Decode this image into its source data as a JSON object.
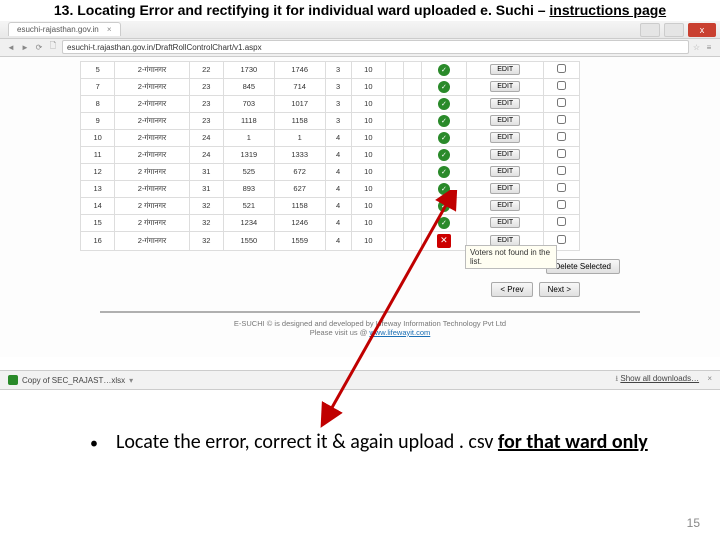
{
  "slide": {
    "title_prefix": "13.  Locating Error and rectifying it for individual ward uploaded e. Suchi – ",
    "title_underlined": "instructions page",
    "page_number": "15"
  },
  "browser": {
    "tab_title": "esuchi-rajasthan.gov.in",
    "url": "esuchi-t.rajasthan.gov.in/DraftRollControlChart/v1.aspx",
    "close_label": "x"
  },
  "tooltip": "Voters not found in the list.",
  "actions": {
    "edit": "EDIT",
    "delete_selected": "Delete Selected",
    "prev": "< Prev",
    "next": "Next >"
  },
  "footer": {
    "line1": "E-SUCHI © is designed and developed by Lifeway Information Technology Pvt Ltd",
    "line2_prefix": "Please visit us @ ",
    "link": "www.lifewayit.com"
  },
  "download": {
    "file": "Copy of SEC_RAJAST…xlsx",
    "show_all": "Show all downloads…"
  },
  "instruction": {
    "bullet": "•",
    "text_plain": "Locate the error, correct it & again upload . csv ",
    "text_und": "for that ward only"
  },
  "rows": [
    {
      "c": [
        "5",
        "2-गंगानगर",
        "22",
        "1730",
        "1746",
        "3",
        "10",
        "",
        ""
      ],
      "ok": true
    },
    {
      "c": [
        "7",
        "2-गंगानगर",
        "23",
        "845",
        "714",
        "3",
        "10",
        "",
        ""
      ],
      "ok": true
    },
    {
      "c": [
        "8",
        "2-गंगानगर",
        "23",
        "703",
        "1017",
        "3",
        "10",
        "",
        ""
      ],
      "ok": true
    },
    {
      "c": [
        "9",
        "2-गंगानगर",
        "23",
        "1118",
        "1158",
        "3",
        "10",
        "",
        ""
      ],
      "ok": true
    },
    {
      "c": [
        "10",
        "2-गंगानगर",
        "24",
        "1",
        "1",
        "4",
        "10",
        "",
        ""
      ],
      "ok": true
    },
    {
      "c": [
        "11",
        "2-गंगानगर",
        "24",
        "1319",
        "1333",
        "4",
        "10",
        "",
        ""
      ],
      "ok": true
    },
    {
      "c": [
        "12",
        "2 गंगानगर",
        "31",
        "525",
        "672",
        "4",
        "10",
        "",
        ""
      ],
      "ok": true
    },
    {
      "c": [
        "13",
        "2-गंगानगर",
        "31",
        "893",
        "627",
        "4",
        "10",
        "",
        ""
      ],
      "ok": true
    },
    {
      "c": [
        "14",
        "2 गंगानगर",
        "32",
        "521",
        "1158",
        "4",
        "10",
        "",
        ""
      ],
      "ok": true
    },
    {
      "c": [
        "15",
        "2 गंगानगर",
        "32",
        "1234",
        "1246",
        "4",
        "10",
        "",
        ""
      ],
      "ok": true
    },
    {
      "c": [
        "16",
        "2-गंगानगर",
        "32",
        "1550",
        "1559",
        "4",
        "10",
        "",
        ""
      ],
      "ok": false
    }
  ]
}
